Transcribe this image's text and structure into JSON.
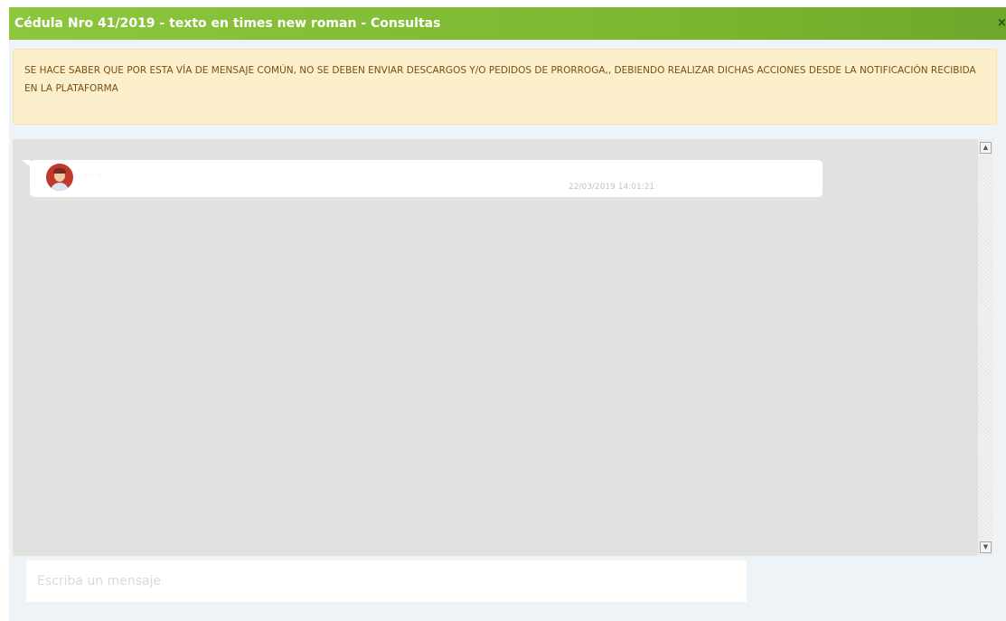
{
  "dialog": {
    "title": "Cédula Nro 41/2019 - texto en times new roman - Consultas",
    "close_label": "×"
  },
  "notice": {
    "text": "SE HACE SABER QUE POR ESTA VÍA DE MENSAJE COMÚN, NO SE DEBEN ENVIAR DESCARGOS Y/O PEDIDOS DE PRORROGA,, DEBIENDO REALIZAR DICHAS ACCIONES DESDE LA NOTIFICACIÓN RECIBIDA EN LA PLATAFORMA"
  },
  "messages": [
    {
      "sender": "- · -",
      "timestamp": "22/03/2019 14:01:21",
      "avatar_icon": "user-avatar-icon"
    }
  ],
  "scrollbar": {
    "up_label": "▲",
    "down_label": "▼"
  },
  "input": {
    "placeholder": "Escriba un mensaje",
    "value": ""
  },
  "colors": {
    "titlebar": "#8dc63f",
    "notice_bg": "#fcefcc",
    "notice_text": "#7a4f10",
    "chat_bg": "#e1e1df",
    "avatar": "#c0392b"
  }
}
